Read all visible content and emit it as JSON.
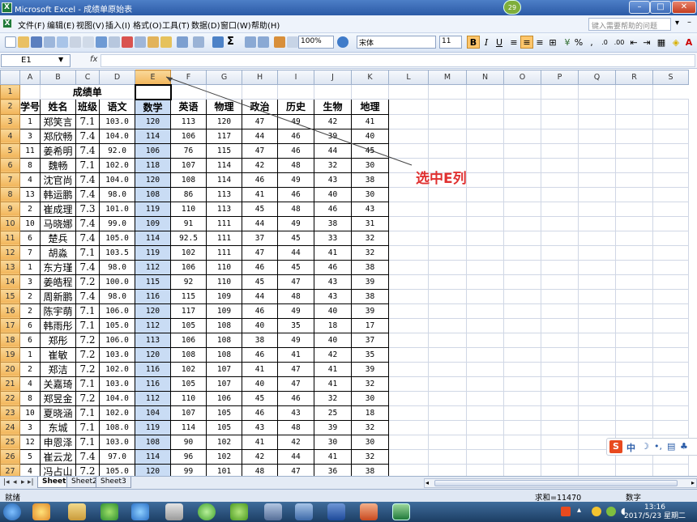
{
  "window": {
    "title": "Microsoft Excel - 成绩单原始表",
    "badge": "29",
    "min": "–",
    "max": "□",
    "close": "✕"
  },
  "menu": [
    "文件(F)",
    "编辑(E)",
    "视图(V)",
    "插入(I)",
    "格式(O)",
    "工具(T)",
    "数据(D)",
    "窗口(W)",
    "帮助(H)"
  ],
  "help_placeholder": "键入需要帮助的问题",
  "toolbar": {
    "zoom": "100%",
    "font_name": "宋体",
    "font_size": "11",
    "bold": "B",
    "italic": "I",
    "underline": "U"
  },
  "formula": {
    "name_box": "E1",
    "fx": "fx",
    "value": ""
  },
  "columns": [
    "A",
    "B",
    "C",
    "D",
    "E",
    "F",
    "G",
    "H",
    "I",
    "J",
    "K",
    "L",
    "M",
    "N",
    "O",
    "P",
    "Q",
    "R",
    "S"
  ],
  "selected_column": "E",
  "sheet_title": "成绩单",
  "headers": [
    "学号",
    "姓名",
    "班级",
    "语文",
    "数学",
    "英语",
    "物理",
    "政治",
    "历史",
    "生物",
    "地理"
  ],
  "rows": [
    {
      "r": "3",
      "a": "1",
      "b": "郑笑言",
      "c": "7.1",
      "d": "103.0",
      "e": "120",
      "f": "113",
      "g": "120",
      "h": "47",
      "i": "49",
      "j": "42",
      "k": "41"
    },
    {
      "r": "4",
      "a": "3",
      "b": "郑欣畅",
      "c": "7.4",
      "d": "104.0",
      "e": "114",
      "f": "106",
      "g": "117",
      "h": "44",
      "i": "46",
      "j": "39",
      "k": "40"
    },
    {
      "r": "5",
      "a": "11",
      "b": "姜希明",
      "c": "7.4",
      "d": "92.0",
      "e": "106",
      "f": "76",
      "g": "115",
      "h": "47",
      "i": "46",
      "j": "44",
      "k": "45"
    },
    {
      "r": "6",
      "a": "8",
      "b": "魏畅",
      "c": "7.1",
      "d": "102.0",
      "e": "118",
      "f": "107",
      "g": "114",
      "h": "42",
      "i": "48",
      "j": "32",
      "k": "30"
    },
    {
      "r": "7",
      "a": "4",
      "b": "沈官尚",
      "c": "7.4",
      "d": "104.0",
      "e": "120",
      "f": "108",
      "g": "114",
      "h": "46",
      "i": "49",
      "j": "43",
      "k": "38"
    },
    {
      "r": "8",
      "a": "13",
      "b": "韩运鹏",
      "c": "7.4",
      "d": "98.0",
      "e": "108",
      "f": "86",
      "g": "113",
      "h": "41",
      "i": "46",
      "j": "40",
      "k": "30"
    },
    {
      "r": "9",
      "a": "2",
      "b": "崔成理",
      "c": "7.3",
      "d": "101.0",
      "e": "119",
      "f": "110",
      "g": "113",
      "h": "45",
      "i": "48",
      "j": "46",
      "k": "43"
    },
    {
      "r": "10",
      "a": "10",
      "b": "马晓娜",
      "c": "7.4",
      "d": "99.0",
      "e": "109",
      "f": "91",
      "g": "111",
      "h": "44",
      "i": "49",
      "j": "38",
      "k": "31"
    },
    {
      "r": "11",
      "a": "6",
      "b": "楚兵",
      "c": "7.4",
      "d": "105.0",
      "e": "114",
      "f": "92.5",
      "g": "111",
      "h": "37",
      "i": "45",
      "j": "33",
      "k": "32"
    },
    {
      "r": "12",
      "a": "7",
      "b": "胡淼",
      "c": "7.1",
      "d": "103.5",
      "e": "119",
      "f": "102",
      "g": "111",
      "h": "47",
      "i": "44",
      "j": "41",
      "k": "32"
    },
    {
      "r": "13",
      "a": "1",
      "b": "东方瑾",
      "c": "7.4",
      "d": "98.0",
      "e": "112",
      "f": "106",
      "g": "110",
      "h": "46",
      "i": "45",
      "j": "46",
      "k": "38"
    },
    {
      "r": "14",
      "a": "3",
      "b": "姜皓程",
      "c": "7.2",
      "d": "100.0",
      "e": "115",
      "f": "92",
      "g": "110",
      "h": "45",
      "i": "47",
      "j": "43",
      "k": "39"
    },
    {
      "r": "15",
      "a": "2",
      "b": "周新鹏",
      "c": "7.4",
      "d": "98.0",
      "e": "116",
      "f": "115",
      "g": "109",
      "h": "44",
      "i": "48",
      "j": "43",
      "k": "38"
    },
    {
      "r": "16",
      "a": "2",
      "b": "陈宇萌",
      "c": "7.1",
      "d": "106.0",
      "e": "120",
      "f": "117",
      "g": "109",
      "h": "46",
      "i": "49",
      "j": "40",
      "k": "39"
    },
    {
      "r": "17",
      "a": "6",
      "b": "韩雨彤",
      "c": "7.1",
      "d": "105.0",
      "e": "112",
      "f": "105",
      "g": "108",
      "h": "40",
      "i": "35",
      "j": "18",
      "k": "17"
    },
    {
      "r": "18",
      "a": "6",
      "b": "郑彤",
      "c": "7.2",
      "d": "106.0",
      "e": "113",
      "f": "106",
      "g": "108",
      "h": "38",
      "i": "49",
      "j": "40",
      "k": "37"
    },
    {
      "r": "19",
      "a": "1",
      "b": "崔敏",
      "c": "7.2",
      "d": "103.0",
      "e": "120",
      "f": "108",
      "g": "108",
      "h": "46",
      "i": "41",
      "j": "42",
      "k": "35"
    },
    {
      "r": "20",
      "a": "2",
      "b": "郑洁",
      "c": "7.2",
      "d": "102.0",
      "e": "116",
      "f": "102",
      "g": "107",
      "h": "41",
      "i": "47",
      "j": "41",
      "k": "39"
    },
    {
      "r": "21",
      "a": "4",
      "b": "关嘉琦",
      "c": "7.1",
      "d": "103.0",
      "e": "116",
      "f": "105",
      "g": "107",
      "h": "40",
      "i": "47",
      "j": "41",
      "k": "32"
    },
    {
      "r": "22",
      "a": "8",
      "b": "郑昱金",
      "c": "7.2",
      "d": "104.0",
      "e": "112",
      "f": "110",
      "g": "106",
      "h": "45",
      "i": "46",
      "j": "32",
      "k": "30"
    },
    {
      "r": "23",
      "a": "10",
      "b": "夏晓涵",
      "c": "7.1",
      "d": "102.0",
      "e": "104",
      "f": "107",
      "g": "105",
      "h": "46",
      "i": "43",
      "j": "25",
      "k": "18"
    },
    {
      "r": "24",
      "a": "3",
      "b": "东城",
      "c": "7.1",
      "d": "108.0",
      "e": "119",
      "f": "114",
      "g": "105",
      "h": "43",
      "i": "48",
      "j": "39",
      "k": "32"
    },
    {
      "r": "25",
      "a": "12",
      "b": "申恩泽",
      "c": "7.1",
      "d": "103.0",
      "e": "108",
      "f": "90",
      "g": "102",
      "h": "41",
      "i": "42",
      "j": "30",
      "k": "30"
    },
    {
      "r": "26",
      "a": "5",
      "b": "崔云龙",
      "c": "7.4",
      "d": "97.0",
      "e": "114",
      "f": "96",
      "g": "102",
      "h": "42",
      "i": "44",
      "j": "41",
      "k": "32"
    },
    {
      "r": "27",
      "a": "4",
      "b": "冯占山",
      "c": "7.2",
      "d": "105.0",
      "e": "120",
      "f": "99",
      "g": "101",
      "h": "48",
      "i": "47",
      "j": "36",
      "k": "38"
    },
    {
      "r": "28",
      "a": "14",
      "b": "赵昕",
      "c": "7.4",
      "d": "96.0",
      "e": "106",
      "f": "79",
      "g": "99",
      "h": "46",
      "i": "45",
      "j": "35",
      "k": "38"
    }
  ],
  "sheets": [
    "Sheet1",
    "Sheet2",
    "Sheet3"
  ],
  "status": {
    "ready": "就绪",
    "sum": "求和=11470",
    "mode": "数字"
  },
  "annotation": "选中E列",
  "clock": {
    "time": "13:16",
    "date": "2017/5/23 星期二"
  },
  "colors": {
    "selection": "#c9dcf4",
    "header_highlight": "#f2b55a",
    "annotation": "#e03030"
  }
}
